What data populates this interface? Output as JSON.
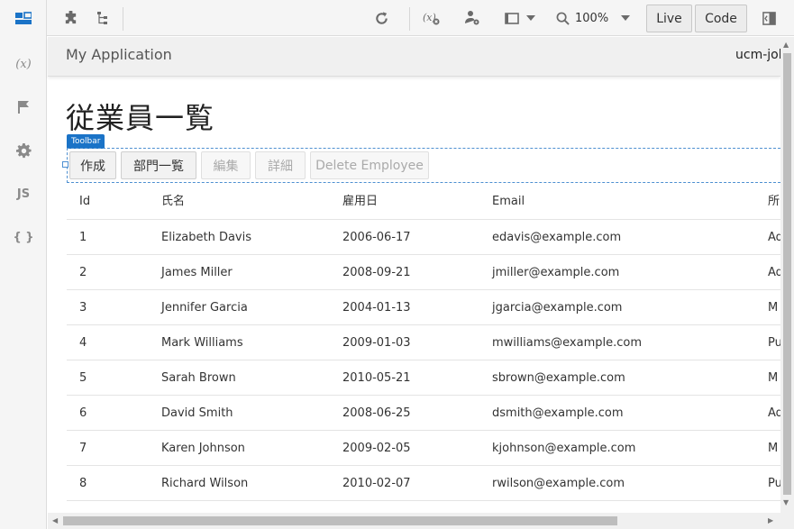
{
  "leftbar": {
    "items": [
      {
        "icon": "page-designer-icon",
        "active": true
      },
      {
        "icon": "variables-icon",
        "label": "(x)"
      },
      {
        "icon": "flag-icon"
      },
      {
        "icon": "gear-icon"
      },
      {
        "icon": "javascript-icon",
        "label": "JS"
      },
      {
        "icon": "json-icon",
        "label": "{ }"
      }
    ]
  },
  "topbar": {
    "zoom": "100%",
    "live_label": "Live",
    "code_label": "Code"
  },
  "app": {
    "title": "My Application",
    "user": "ucm-joh"
  },
  "page": {
    "title": "従業員一覧",
    "toolbar_tag": "Toolbar",
    "buttons": {
      "create": "作成",
      "departments": "部門一覧",
      "edit": "編集",
      "details": "詳細",
      "delete": "Delete Employee"
    }
  },
  "table": {
    "columns": [
      "Id",
      "氏名",
      "雇用日",
      "Email",
      "所"
    ],
    "rows": [
      {
        "id": "1",
        "name": "Elizabeth Davis",
        "hire": "2006-06-17",
        "email": "edavis@example.com",
        "dept": "Ad"
      },
      {
        "id": "2",
        "name": "James Miller",
        "hire": "2008-09-21",
        "email": "jmiller@example.com",
        "dept": "Ad"
      },
      {
        "id": "3",
        "name": "Jennifer Garcia",
        "hire": "2004-01-13",
        "email": "jgarcia@example.com",
        "dept": "M"
      },
      {
        "id": "4",
        "name": "Mark Williams",
        "hire": "2009-01-03",
        "email": "mwilliams@example.com",
        "dept": "Pu"
      },
      {
        "id": "5",
        "name": "Sarah Brown",
        "hire": "2010-05-21",
        "email": "sbrown@example.com",
        "dept": "M"
      },
      {
        "id": "6",
        "name": "David Smith",
        "hire": "2008-06-25",
        "email": "dsmith@example.com",
        "dept": "Ad"
      },
      {
        "id": "7",
        "name": "Karen Johnson",
        "hire": "2009-02-05",
        "email": "kjohnson@example.com",
        "dept": "M"
      },
      {
        "id": "8",
        "name": "Richard Wilson",
        "hire": "2010-02-07",
        "email": "rwilson@example.com",
        "dept": "Pu"
      }
    ]
  },
  "colors": {
    "accent": "#1a73c7",
    "selection_border": "#4d8fd1"
  }
}
